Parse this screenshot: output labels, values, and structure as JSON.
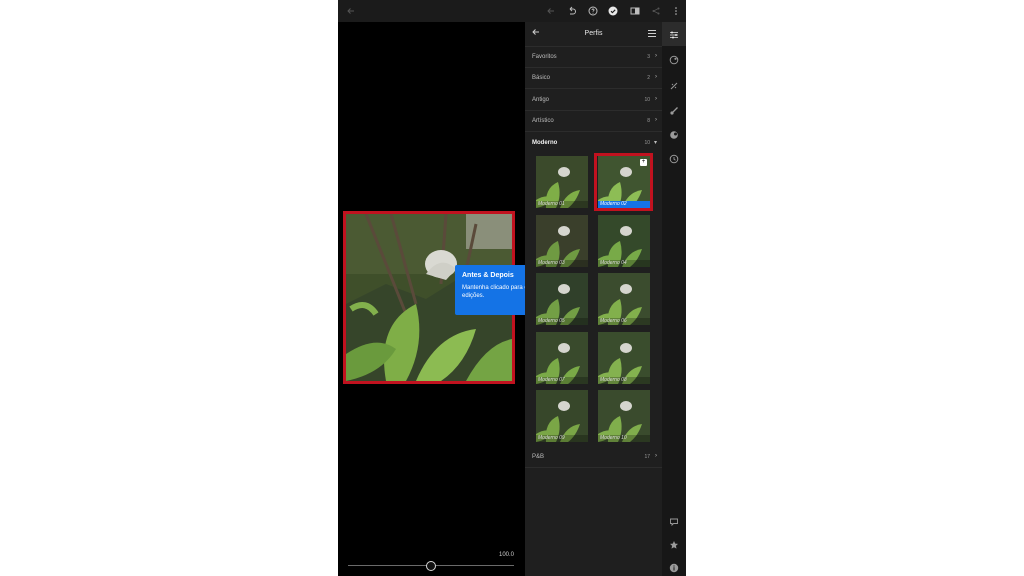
{
  "topbar": {
    "icons": [
      "back-arrow-icon",
      "undo-icon",
      "redo-icon",
      "help-icon",
      "check-icon",
      "compare-icon",
      "share-icon",
      "more-icon"
    ]
  },
  "editor": {
    "slider_value": "100.0",
    "slider_fraction": 0.5
  },
  "tooltip": {
    "title": "Antes & Depois",
    "body": "Mantenha clicado para comparar as edições."
  },
  "panel": {
    "title": "Perfis",
    "categories": [
      {
        "label": "Favoritos",
        "count": "3"
      },
      {
        "label": "Básico",
        "count": "2"
      },
      {
        "label": "Antigo",
        "count": "10"
      },
      {
        "label": "Artístico",
        "count": "8"
      },
      {
        "label": "Moderno",
        "count": "10"
      },
      {
        "label": "P&B",
        "count": "17"
      }
    ],
    "thumbs": [
      "Moderno 01",
      "Moderno 02",
      "Moderno 03",
      "Moderno 04",
      "Moderno 05",
      "Moderno 06",
      "Moderno 07",
      "Moderno 08",
      "Moderno 09",
      "Moderno 10"
    ]
  },
  "colors": {
    "accent": "#1473e6",
    "highlight": "#c1121f",
    "panel_bg": "#1f1f1f"
  },
  "right_toolbar": {
    "icons": [
      "sliders-icon",
      "presets-icon",
      "heal-icon",
      "brush-icon",
      "masking-icon",
      "history-icon",
      "comment-icon",
      "star-icon",
      "info-icon"
    ]
  }
}
